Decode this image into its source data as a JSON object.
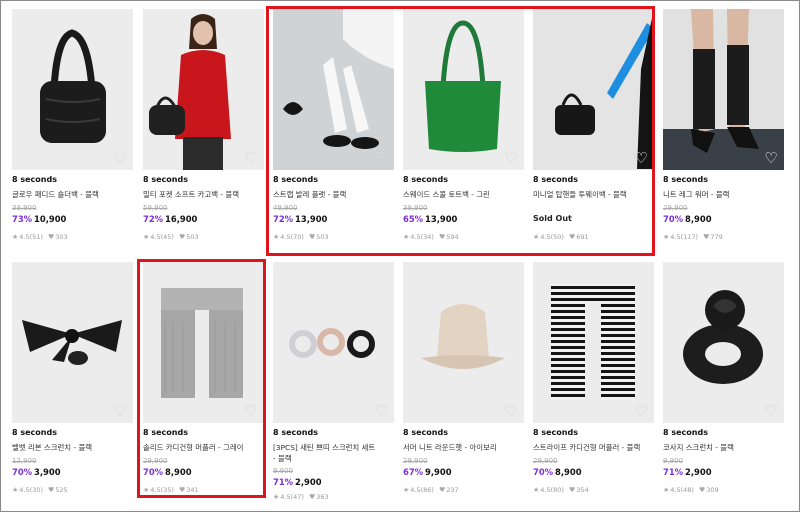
{
  "colors": {
    "discount": "#7b2fd6",
    "highlight": "#e0141b",
    "image_bg": "#ececec"
  },
  "icons": {
    "wishlist": "heart-outline-icon",
    "rating": "star-icon",
    "likes": "heart-icon"
  },
  "products": [
    {
      "brand": "8 seconds",
      "name": "글로우 패디드 숄더백 - 블랙",
      "original_price": "39,900",
      "discount": "73%",
      "price": "10,900",
      "rating": "4.5(51)",
      "likes": "303"
    },
    {
      "brand": "8 seconds",
      "name": "밀티 포켓 소프트 카고백 - 블랙",
      "original_price": "59,900",
      "discount": "72%",
      "price": "16,900",
      "rating": "4.5(45)",
      "likes": "503"
    },
    {
      "brand": "8 seconds",
      "name": "스트랩 발레 플랫 - 블랙",
      "original_price": "49,900",
      "discount": "72%",
      "price": "13,900",
      "rating": "4.5(70)",
      "likes": "503"
    },
    {
      "brand": "8 seconds",
      "name": "스웨이드 스몰 토트백 - 그린",
      "original_price": "39,900",
      "discount": "65%",
      "price": "13,900",
      "rating": "4.5(34)",
      "likes": "594"
    },
    {
      "brand": "8 seconds",
      "name": "미니얼 탑핸들 투웨이백 - 블랙",
      "sold_out": "Sold Out",
      "rating": "4.5(50)",
      "likes": "691"
    },
    {
      "brand": "8 seconds",
      "name": "니트 레그 워머 - 블랙",
      "original_price": "29,900",
      "discount": "70%",
      "price": "8,900",
      "rating": "4.5(117)",
      "likes": "779"
    },
    {
      "brand": "8 seconds",
      "name": "벨벳 리본 스크런치 - 블랙",
      "original_price": "12,900",
      "discount": "70%",
      "price": "3,900",
      "rating": "4.5(30)",
      "likes": "525"
    },
    {
      "brand": "8 seconds",
      "name": "솔리드 카디건형 머플러 - 그레이",
      "original_price": "29,900",
      "discount": "70%",
      "price": "8,900",
      "rating": "4.5(35)",
      "likes": "341"
    },
    {
      "brand": "8 seconds",
      "name": "[3PCS] 새틴 쁘띠 스크런치 세트",
      "name_line2": "- 블랙",
      "original_price": "9,900",
      "discount": "71%",
      "price": "2,900",
      "rating": "4.5(47)",
      "likes": "363"
    },
    {
      "brand": "8 seconds",
      "name": "서머 니트 라운드햇 - 아이보리",
      "original_price": "29,900",
      "discount": "67%",
      "price": "9,900",
      "rating": "4.5(86)",
      "likes": "237"
    },
    {
      "brand": "8 seconds",
      "name": "스트라이프 카디건형 머플러 - 블랙",
      "original_price": "29,900",
      "discount": "70%",
      "price": "8,900",
      "rating": "4.5(80)",
      "likes": "354"
    },
    {
      "brand": "8 seconds",
      "name": "코사지 스크런치 - 블랙",
      "original_price": "9,900",
      "discount": "71%",
      "price": "2,900",
      "rating": "4.5(48)",
      "likes": "309"
    }
  ]
}
